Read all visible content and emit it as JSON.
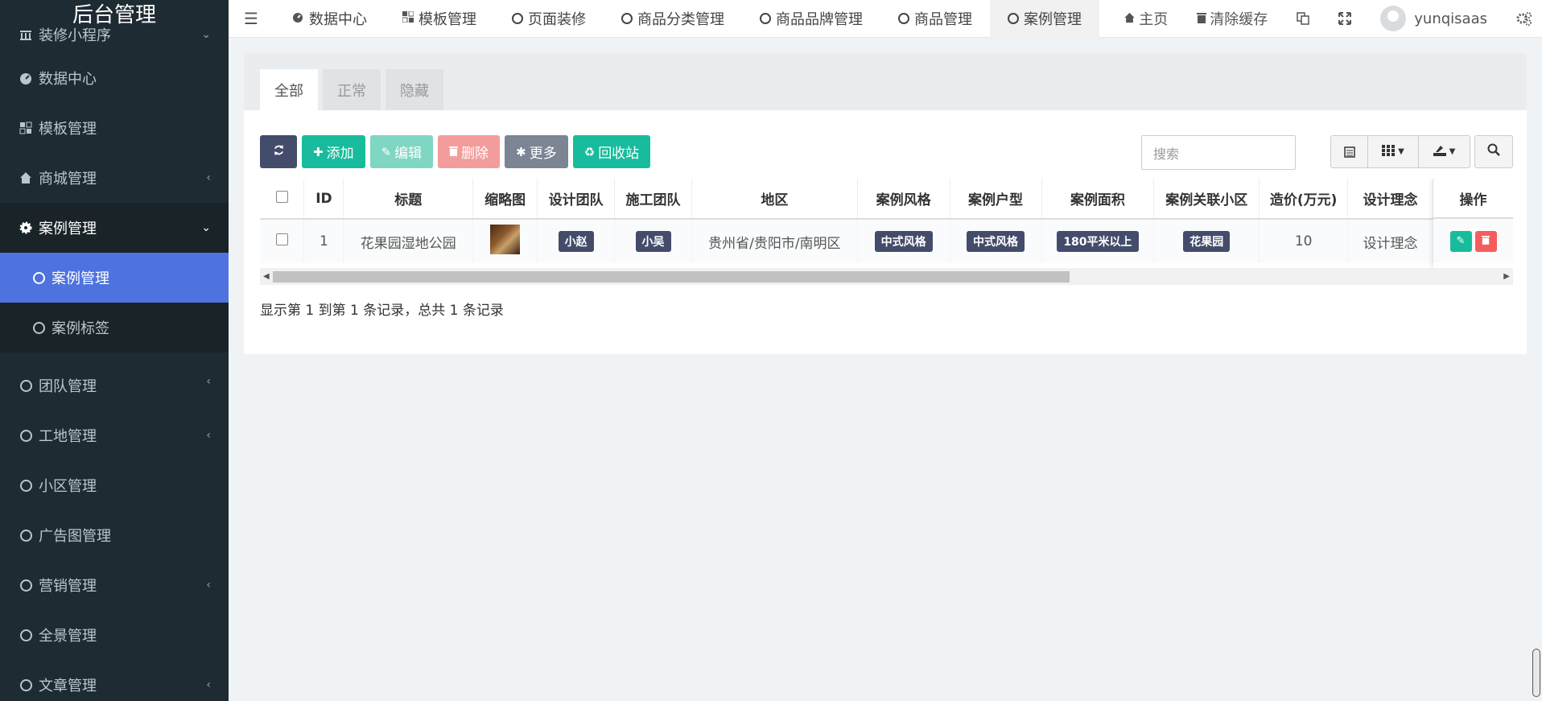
{
  "sidebar": {
    "logo": "后台管理",
    "items": [
      {
        "label": "装修小程序"
      },
      {
        "label": "数据中心"
      },
      {
        "label": "模板管理"
      },
      {
        "label": "商城管理"
      },
      {
        "label": "案例管理"
      },
      {
        "label": "案例管理"
      },
      {
        "label": "案例标签"
      },
      {
        "label": "团队管理"
      },
      {
        "label": "工地管理"
      },
      {
        "label": "小区管理"
      },
      {
        "label": "广告图管理"
      },
      {
        "label": "营销管理"
      },
      {
        "label": "全景管理"
      },
      {
        "label": "文章管理"
      }
    ]
  },
  "topnav": {
    "tabs": [
      {
        "label": "数据中心"
      },
      {
        "label": "模板管理"
      },
      {
        "label": "页面装修"
      },
      {
        "label": "商品分类管理"
      },
      {
        "label": "商品品牌管理"
      },
      {
        "label": "商品管理"
      },
      {
        "label": "案例管理"
      }
    ],
    "home": "主页",
    "clear_cache": "清除缓存",
    "username": "yunqisaas"
  },
  "content_tabs": [
    "全部",
    "正常",
    "隐藏"
  ],
  "toolbar": {
    "add": "添加",
    "edit": "编辑",
    "delete": "删除",
    "more": "更多",
    "recycle": "回收站",
    "search_placeholder": "搜索"
  },
  "table": {
    "headers": [
      "ID",
      "标题",
      "缩略图",
      "设计团队",
      "施工团队",
      "地区",
      "案例风格",
      "案例户型",
      "案例面积",
      "案例关联小区",
      "造价(万元)",
      "设计理念",
      "操作"
    ],
    "row": {
      "id": "1",
      "title": "花果园湿地公园",
      "design_team": "小赵",
      "build_team": "小吴",
      "region": "贵州省/贵阳市/南明区",
      "style": "中式风格",
      "house_type": "中式风格",
      "area": "180平米以上",
      "community": "花果园",
      "cost": "10",
      "concept": "设计理念"
    }
  },
  "footer": "显示第 1 到第 1 条记录，总共 1 条记录",
  "colors": {
    "sidebar_bg": "#1f2b33",
    "active_blue": "#4e73df",
    "green": "#18bc9c",
    "dark": "#444c6b",
    "red": "#f75c5c"
  }
}
